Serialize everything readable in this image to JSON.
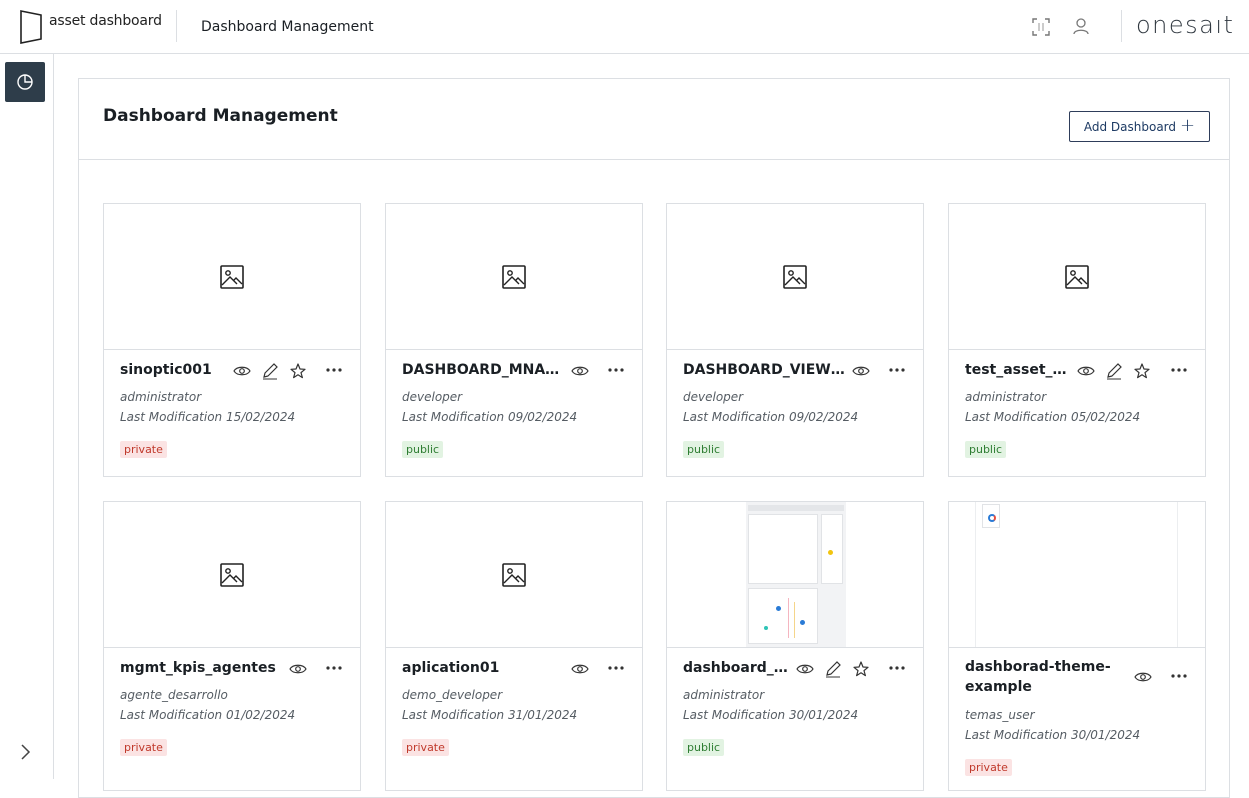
{
  "header": {
    "app_name": "asset dashboard",
    "title": "Dashboard Management",
    "brand": "onesaıt"
  },
  "panel": {
    "title": "Dashboard Management",
    "add_button": "Add Dashboard"
  },
  "cards": [
    {
      "title": "sinoptic001",
      "owner": "administrator",
      "modified": "Last Modification 15/02/2024",
      "visibility": "private"
    },
    {
      "title": "DASHBOARD_MNAGE...",
      "owner": "developer",
      "modified": "Last Modification 09/02/2024",
      "visibility": "public"
    },
    {
      "title": "DASHBOARD_VIEW_A...",
      "owner": "developer",
      "modified": "Last Modification 09/02/2024",
      "visibility": "public"
    },
    {
      "title": "test_asset_d...",
      "owner": "administrator",
      "modified": "Last Modification 05/02/2024",
      "visibility": "public"
    },
    {
      "title": "mgmt_kpis_agentes",
      "owner": "agente_desarrollo",
      "modified": "Last Modification 01/02/2024",
      "visibility": "private"
    },
    {
      "title": "aplication01",
      "owner": "demo_developer",
      "modified": "Last Modification 31/01/2024",
      "visibility": "private"
    },
    {
      "title": "dashboard_Ul...",
      "owner": "administrator",
      "modified": "Last Modification 30/01/2024",
      "visibility": "public"
    },
    {
      "title": "dashborad-theme-example",
      "owner": "temas_user",
      "modified": "Last Modification 30/01/2024",
      "visibility": "private"
    }
  ],
  "icons": {
    "logo": "logo-mark-icon",
    "fullscreen": "fullscreen-icon",
    "user": "user-icon",
    "nav_dashboard": "pie-chart-icon",
    "expand": "chevron-right-icon",
    "image": "image-placeholder-icon",
    "view": "eye-icon",
    "edit": "pencil-icon",
    "favorite": "star-icon",
    "more": "more-horizontal-icon"
  },
  "colors": {
    "sidebar_active": "#2e3d4a",
    "private_bg": "#fbe3e3",
    "private_text": "#c0392b",
    "public_bg": "#e2f3e2",
    "public_text": "#2e7d32",
    "button_border": "#2e3d5a"
  }
}
